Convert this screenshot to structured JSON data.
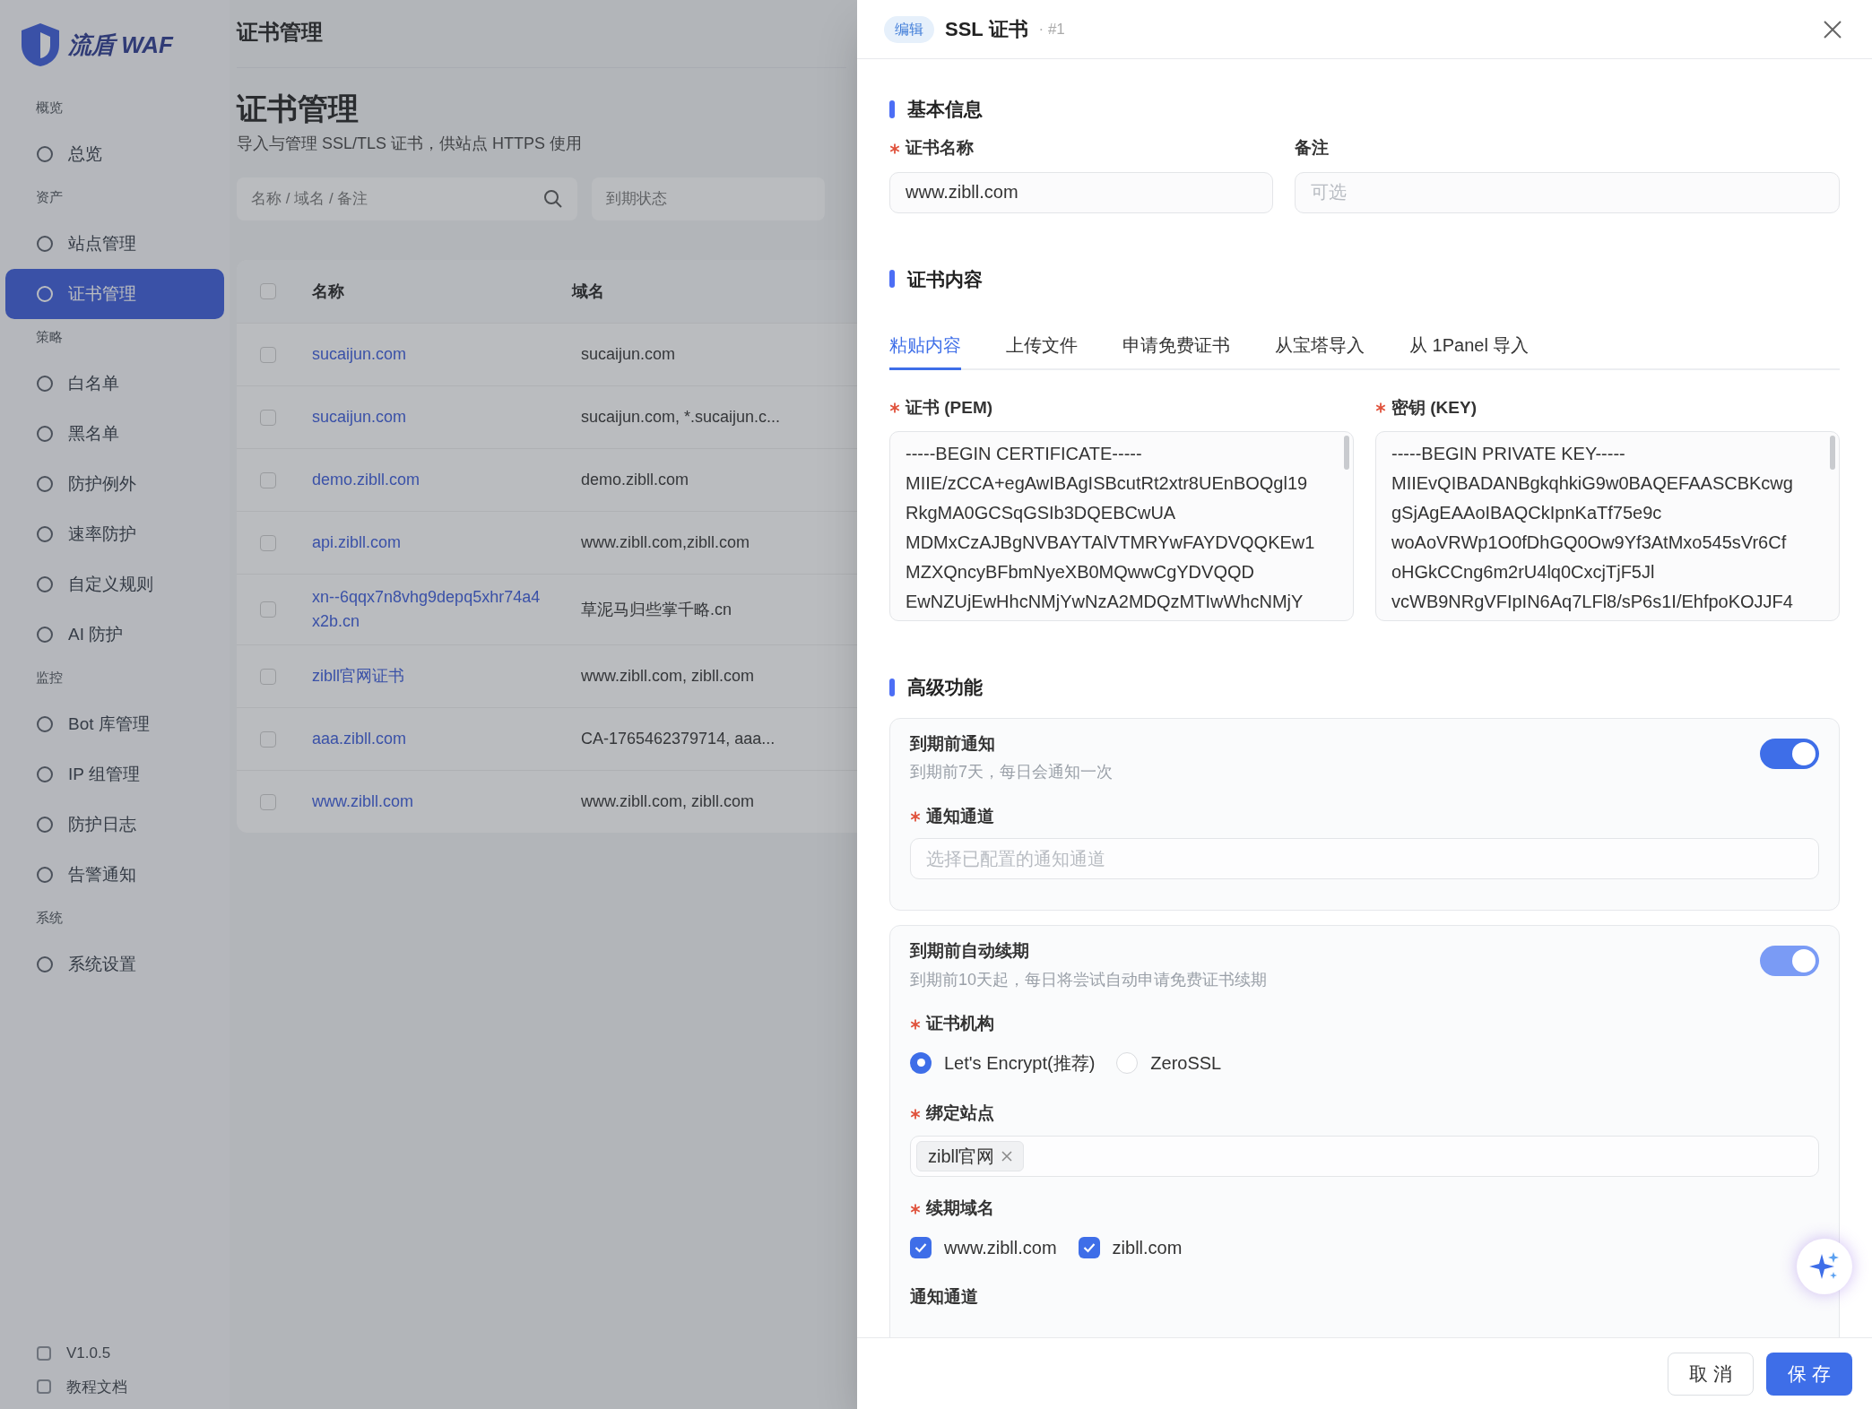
{
  "background": {
    "logo": {
      "name": "流盾 WAF"
    },
    "sidebar": {
      "sections": [
        {
          "heading": "概览",
          "items": [
            {
              "label": "总览",
              "selected": false
            }
          ]
        },
        {
          "heading": "资产",
          "items": [
            {
              "label": "站点管理",
              "selected": false
            },
            {
              "label": "证书管理",
              "selected": true
            }
          ]
        },
        {
          "heading": "策略",
          "items": [
            {
              "label": "白名单",
              "selected": false
            },
            {
              "label": "黑名单",
              "selected": false
            },
            {
              "label": "防护例外",
              "selected": false
            },
            {
              "label": "速率防护",
              "selected": false
            },
            {
              "label": "自定义规则",
              "selected": false
            },
            {
              "label": "AI 防护",
              "selected": false
            }
          ]
        },
        {
          "heading": "监控",
          "items": [
            {
              "label": "Bot 库管理",
              "selected": false
            },
            {
              "label": "IP 组管理",
              "selected": false
            },
            {
              "label": "防护日志",
              "selected": false
            },
            {
              "label": "告警通知",
              "selected": false
            }
          ]
        },
        {
          "heading": "系统",
          "items": [
            {
              "label": "系统设置",
              "selected": false
            }
          ]
        }
      ],
      "footer_items": [
        {
          "label": "V1.0.5"
        },
        {
          "label": "教程文档"
        }
      ]
    },
    "breadcrumb": "证书管理",
    "title": "证书管理",
    "subtitle": "导入与管理 SSL/TLS 证书，供站点 HTTPS 使用",
    "search": {
      "placeholder": "名称 / 域名 / 备注"
    },
    "filter": {
      "placeholder": "到期状态"
    },
    "table": {
      "columns": [
        "名称",
        "域名"
      ],
      "header_checked": false,
      "rows": [
        {
          "name": "sucaijun.com",
          "domains": "sucaijun.com",
          "checked": false
        },
        {
          "name": "sucaijun.com",
          "domains": "sucaijun.com, *.sucaijun.c...",
          "checked": false
        },
        {
          "name": "demo.zibll.com",
          "domains": "demo.zibll.com",
          "checked": false
        },
        {
          "name": "api.zibll.com",
          "domains": "www.zibll.com,zibll.com",
          "checked": false
        },
        {
          "name": "xn--6qqx7n8vhg9depq5xhr74a4x2b.cn",
          "domains": "草泥马归些掌千略.cn",
          "checked": false
        },
        {
          "name": "zibll官网证书",
          "domains": "www.zibll.com, zibll.com",
          "checked": false
        },
        {
          "name": "aaa.zibll.com",
          "domains": "CA-1765462379714, aaa...",
          "checked": false
        },
        {
          "name": "www.zibll.com",
          "domains": "www.zibll.com, zibll.com",
          "checked": false
        }
      ]
    }
  },
  "drawer": {
    "badge": "编辑",
    "title": "SSL 证书",
    "id": "· #1",
    "basic": {
      "heading": "基本信息",
      "fields": [
        {
          "label": "证书名称",
          "required": true,
          "value": "www.zibll.com"
        },
        {
          "label": "备注",
          "required": false,
          "placeholder": "可选"
        }
      ]
    },
    "content": {
      "heading": "证书内容",
      "tabs": [
        {
          "label": "粘贴内容",
          "selected": true
        },
        {
          "label": "上传文件",
          "selected": false
        },
        {
          "label": "申请免费证书",
          "selected": false
        },
        {
          "label": "从宝塔导入",
          "selected": false
        },
        {
          "label": "从 1Panel 导入",
          "selected": false
        }
      ],
      "areas": [
        {
          "label": "证书 (PEM)",
          "required": true,
          "lines": [
            "-----BEGIN CERTIFICATE-----",
            "MIIE/zCCA+egAwIBAgISBcutRt2xtr8UEnBOQgl19",
            "RkgMA0GCSqGSIb3DQEBCwUA",
            "MDMxCzAJBgNVBAYTAlVTMRYwFAYDVQQKEw1",
            "MZXQncyBFbmNyeXB0MQwwCgYDVQQD",
            "EwNZUjEwHhcNMjYwNzA2MDQzMTIwWhcNMjY"
          ]
        },
        {
          "label": "密钥 (KEY)",
          "required": true,
          "lines": [
            "-----BEGIN PRIVATE KEY-----",
            "MIIEvQIBADANBgkqhkiG9w0BAQEFAASCBKcwg",
            "gSjAgEAAoIBAQCkIpnKaTf75e9c",
            "woAoVRWp1O0fDhGQ0Ow9Yf3AtMxo545sVr6Cf",
            "oHGkCCng6m2rU4lq0CxcjTjF5Jl",
            "vcWB9NRgVFIpIN6Aq7LFl8/sP6s1I/EhfpoKOJJF4"
          ]
        }
      ]
    },
    "advanced": {
      "heading": "高级功能",
      "notify": {
        "title": "到期前通知",
        "description": "到期前7天，每日会通知一次",
        "on": true,
        "disabled": false,
        "channel": {
          "label": "通知通道",
          "required": true,
          "placeholder": "选择已配置的通知通道"
        }
      },
      "renew": {
        "title": "到期前自动续期",
        "description": "到期前10天起，每日将尝试自动申请免费证书续期",
        "on": true,
        "disabled": true,
        "issuer": {
          "label": "证书机构",
          "required": true,
          "options": [
            {
              "label": "Let's Encrypt(推荐)",
              "selected": true
            },
            {
              "label": "ZeroSSL",
              "selected": false
            }
          ]
        },
        "sites": {
          "label": "绑定站点",
          "required": true,
          "tags": [
            "zibll官网"
          ]
        },
        "domains": {
          "label": "续期域名",
          "required": true,
          "options": [
            {
              "label": "www.zibll.com",
              "checked": true
            },
            {
              "label": "zibll.com",
              "checked": true
            }
          ]
        },
        "channel_label": "通知通道"
      }
    },
    "buttons": [
      {
        "label": "取 消",
        "kind": "secondary"
      },
      {
        "label": "保 存",
        "kind": "primary"
      }
    ]
  }
}
